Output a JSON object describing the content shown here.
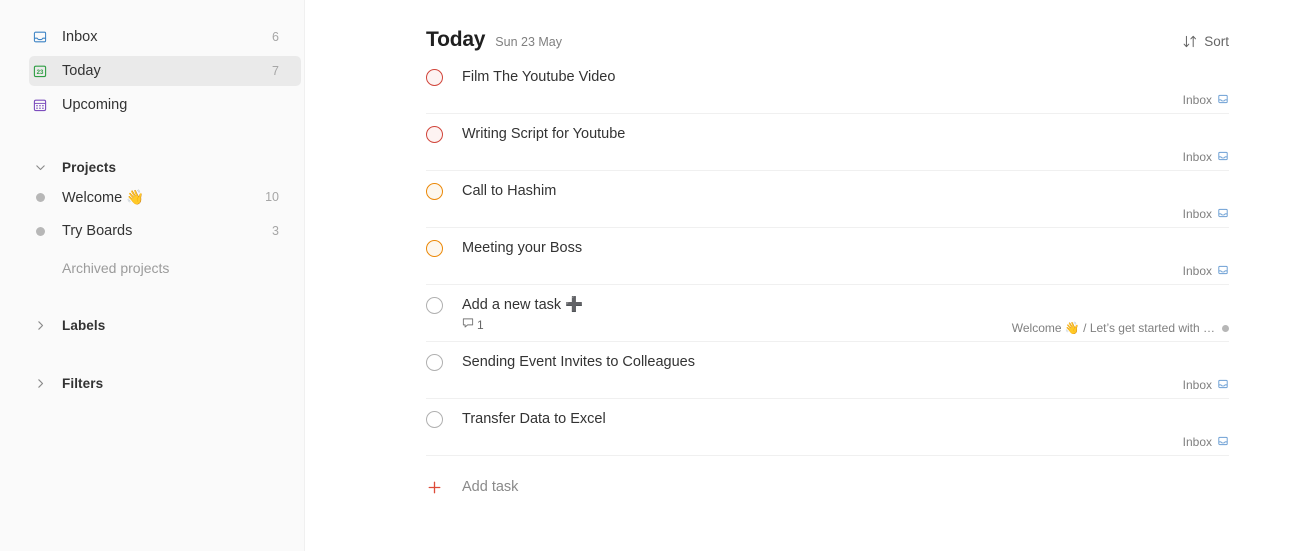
{
  "sidebar": {
    "nav": [
      {
        "label": "Inbox",
        "count": "6",
        "icon": "inbox-icon",
        "active": false
      },
      {
        "label": "Today",
        "count": "7",
        "icon": "calendar-23-icon",
        "active": true
      },
      {
        "label": "Upcoming",
        "count": "",
        "icon": "upcoming-calendar-icon",
        "active": false
      }
    ],
    "projects_section": {
      "title": "Projects",
      "expanded": true
    },
    "projects": [
      {
        "label": "Welcome 👋",
        "count": "10"
      },
      {
        "label": "Try Boards",
        "count": "3"
      }
    ],
    "archived_label": "Archived projects",
    "labels_section": {
      "title": "Labels",
      "expanded": false
    },
    "filters_section": {
      "title": "Filters",
      "expanded": false
    }
  },
  "header": {
    "title": "Today",
    "date": "Sun 23 May",
    "sort_label": "Sort"
  },
  "tasks": [
    {
      "name": "Film The Youtube Video",
      "priority": "p1",
      "tag": "Inbox",
      "tag_type": "inbox",
      "comments": ""
    },
    {
      "name": "Writing Script for Youtube",
      "priority": "p1",
      "tag": "Inbox",
      "tag_type": "inbox",
      "comments": ""
    },
    {
      "name": "Call to Hashim",
      "priority": "p2",
      "tag": "Inbox",
      "tag_type": "inbox",
      "comments": ""
    },
    {
      "name": "Meeting your Boss",
      "priority": "p2",
      "tag": "Inbox",
      "tag_type": "inbox",
      "comments": ""
    },
    {
      "name": "Add a new task ➕",
      "priority": "none",
      "tag": "Welcome 👋 / Let’s get started with …",
      "tag_type": "project",
      "comments": "1"
    },
    {
      "name": "Sending Event Invites to Colleagues",
      "priority": "none",
      "tag": "Inbox",
      "tag_type": "inbox",
      "comments": ""
    },
    {
      "name": "Transfer Data to Excel",
      "priority": "none",
      "tag": "Inbox",
      "tag_type": "inbox",
      "comments": ""
    }
  ],
  "footer": {
    "add_task_label": "Add task"
  },
  "colors": {
    "priority_1": "#d1453b",
    "priority_2": "#eb8909",
    "accent_red": "#dd4b39",
    "sidebar_bg": "#fafafa",
    "active_bg": "#eaeaea"
  }
}
